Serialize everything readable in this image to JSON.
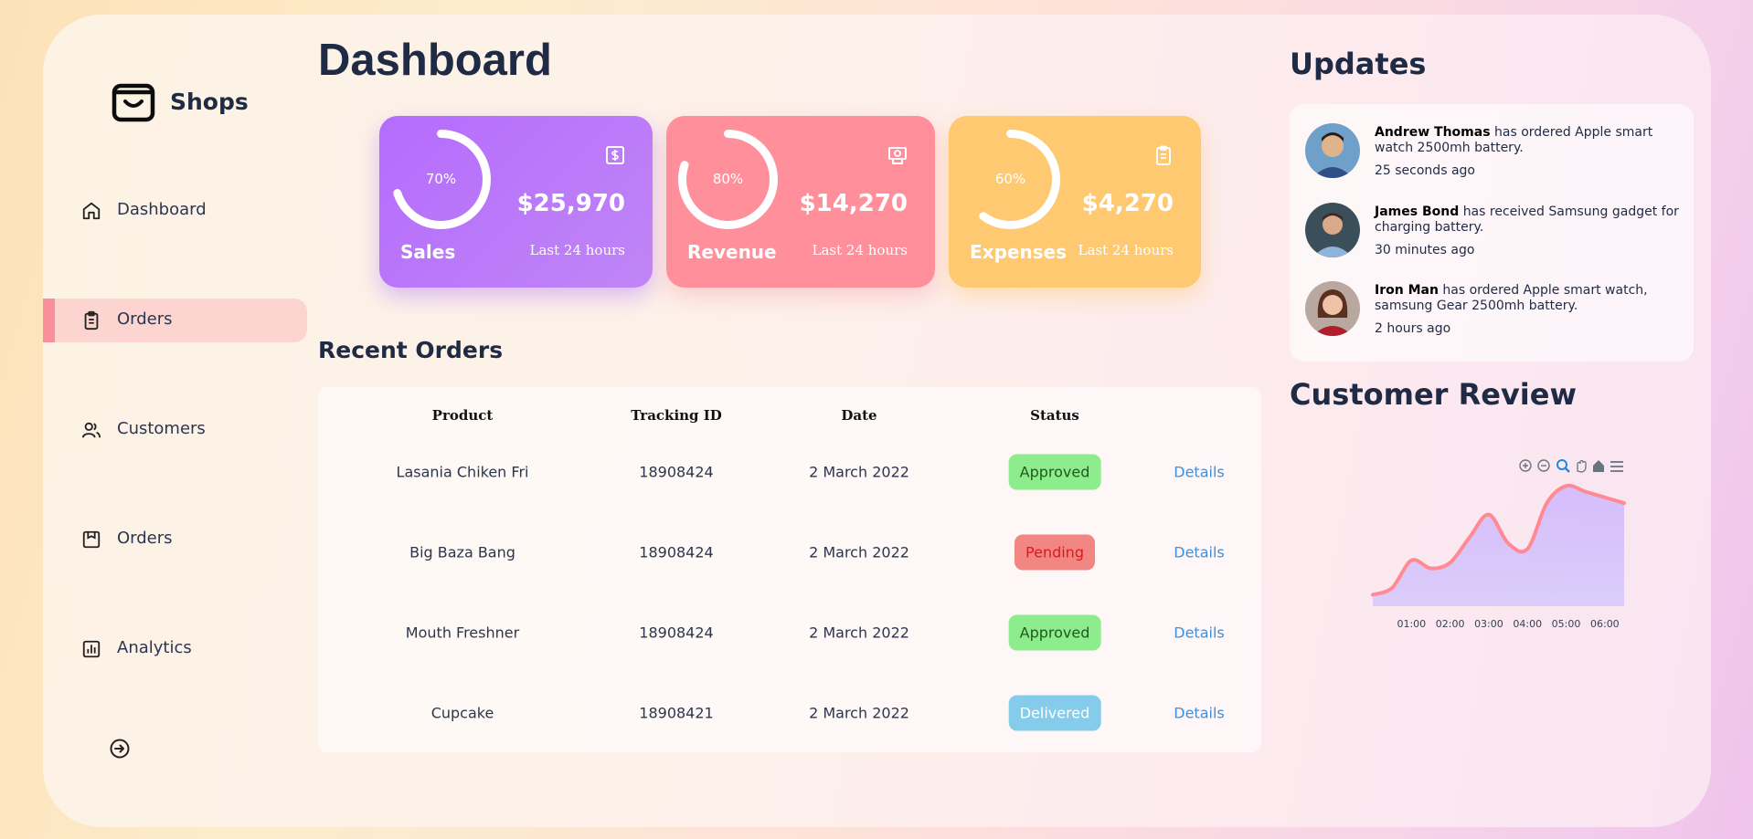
{
  "app": {
    "brand": "Shops",
    "title": "Dashboard"
  },
  "sidebar": {
    "items": [
      {
        "label": "Dashboard",
        "icon": "home-icon",
        "active": false
      },
      {
        "label": "Orders",
        "icon": "clipboard-icon",
        "active": true
      },
      {
        "label": "Customers",
        "icon": "users-icon",
        "active": false
      },
      {
        "label": "Orders",
        "icon": "package-icon",
        "active": false
      },
      {
        "label": "Analytics",
        "icon": "bar-chart-icon",
        "active": false
      }
    ],
    "signout_icon": "sign-out-icon"
  },
  "cards": [
    {
      "label": "Sales",
      "percent": "70%",
      "progress": 0.7,
      "amount": "$25,970",
      "period": "Last 24 hours",
      "icon": "dollar-icon",
      "color": "#b56bfd"
    },
    {
      "label": "Revenue",
      "percent": "80%",
      "progress": 0.8,
      "amount": "$14,270",
      "period": "Last 24 hours",
      "icon": "money-icon",
      "color": "#fe8f9b"
    },
    {
      "label": "Expenses",
      "percent": "60%",
      "progress": 0.6,
      "amount": "$4,270",
      "period": "Last 24 hours",
      "icon": "clipboard-icon",
      "color": "#ffc972"
    }
  ],
  "orders": {
    "title": "Recent Orders",
    "columns": [
      "Product",
      "Tracking ID",
      "Date",
      "Status"
    ],
    "rows": [
      {
        "product": "Lasania Chiken Fri",
        "tracking": "18908424",
        "date": "2 March 2022",
        "status": "Approved",
        "action": "Details"
      },
      {
        "product": "Big Baza Bang",
        "tracking": "18908424",
        "date": "2 March 2022",
        "status": "Pending",
        "action": "Details"
      },
      {
        "product": "Mouth Freshner",
        "tracking": "18908424",
        "date": "2 March 2022",
        "status": "Approved",
        "action": "Details"
      },
      {
        "product": "Cupcake",
        "tracking": "18908421",
        "date": "2 March 2022",
        "status": "Delivered",
        "action": "Details"
      }
    ]
  },
  "updates": {
    "title": "Updates",
    "items": [
      {
        "name": "Andrew Thomas",
        "text": "has ordered Apple smart watch 2500mh battery.",
        "time": "25 seconds ago"
      },
      {
        "name": "James Bond",
        "text": "has received Samsung gadget for charging battery.",
        "time": "30 minutes ago"
      },
      {
        "name": "Iron Man",
        "text": "has ordered Apple smart watch, samsung Gear 2500mh battery.",
        "time": "2 hours ago"
      }
    ]
  },
  "review": {
    "title": "Customer Review",
    "toolbar_icons": [
      "zoom-in-icon",
      "zoom-out-icon",
      "zoom-select-icon",
      "pan-icon",
      "reset-home-icon",
      "menu-icon"
    ]
  },
  "chart_data": {
    "type": "area",
    "categories": [
      "01:00",
      "02:00",
      "03:00",
      "04:00",
      "05:00",
      "06:00"
    ],
    "x": [
      0,
      0.5,
      1,
      1.5,
      2,
      2.5,
      3,
      3.5,
      4,
      4.5,
      5,
      5.5,
      6,
      6.5
    ],
    "values": [
      10,
      16,
      40,
      33,
      38,
      60,
      80,
      55,
      50,
      90,
      105,
      100,
      95,
      90
    ],
    "line_color": "#ff8a94",
    "fill_color": "#d4c3fb"
  }
}
